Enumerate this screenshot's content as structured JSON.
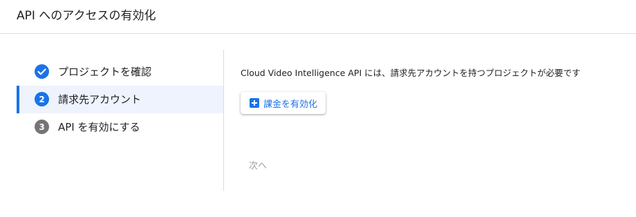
{
  "header": {
    "title": "API へのアクセスの有効化"
  },
  "steps": [
    {
      "number": "",
      "label": "プロジェクトを確認",
      "state": "done"
    },
    {
      "number": "2",
      "label": "請求先アカウント",
      "state": "current"
    },
    {
      "number": "3",
      "label": "API を有効にする",
      "state": "pending"
    }
  ],
  "main": {
    "description": "Cloud Video Intelligence API には、請求先アカウントを持つプロジェクトが必要です",
    "enable_billing_label": "課金を有効化",
    "next_label": "次へ"
  },
  "colors": {
    "accent": "#1a73e8",
    "muted": "#9aa0a6",
    "pending_step": "#757575"
  }
}
